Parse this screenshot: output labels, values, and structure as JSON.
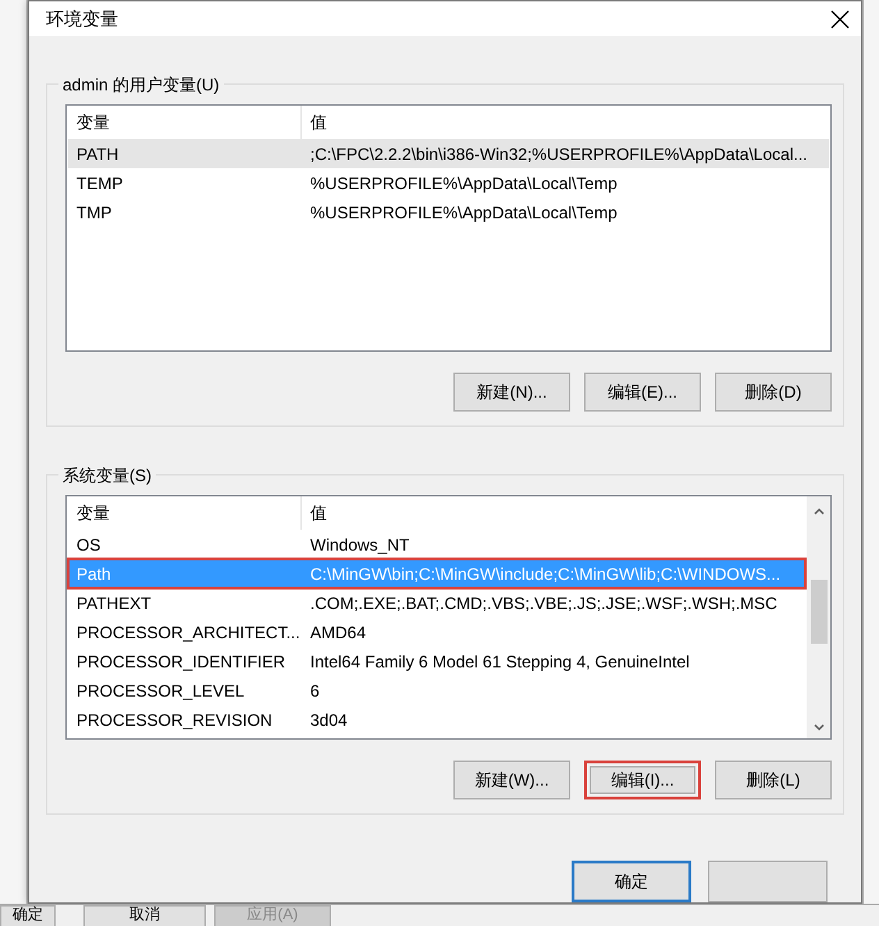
{
  "window": {
    "title": "环境变量"
  },
  "user_vars": {
    "label": "admin 的用户变量(U)",
    "columns": [
      "变量",
      "值"
    ],
    "rows": [
      {
        "name": "PATH",
        "value": ";C:\\FPC\\2.2.2\\bin\\i386-Win32;%USERPROFILE%\\AppData\\Local...",
        "selected": false,
        "hovered": true
      },
      {
        "name": "TEMP",
        "value": "%USERPROFILE%\\AppData\\Local\\Temp",
        "selected": false,
        "hovered": false
      },
      {
        "name": "TMP",
        "value": "%USERPROFILE%\\AppData\\Local\\Temp",
        "selected": false,
        "hovered": false
      }
    ],
    "buttons": [
      {
        "label": "新建(N)...",
        "annotated": false
      },
      {
        "label": "编辑(E)...",
        "annotated": false
      },
      {
        "label": "删除(D)",
        "annotated": false
      }
    ]
  },
  "system_vars": {
    "label": "系统变量(S)",
    "columns": [
      "变量",
      "值"
    ],
    "rows": [
      {
        "name": "OS",
        "value": "Windows_NT",
        "selected": false,
        "annotated": false
      },
      {
        "name": "Path",
        "value": "C:\\MinGW\\bin;C:\\MinGW\\include;C:\\MinGW\\lib;C:\\WINDOWS...",
        "selected": true,
        "annotated": true
      },
      {
        "name": "PATHEXT",
        "value": ".COM;.EXE;.BAT;.CMD;.VBS;.VBE;.JS;.JSE;.WSF;.WSH;.MSC",
        "selected": false,
        "annotated": false
      },
      {
        "name": "PROCESSOR_ARCHITECT...",
        "value": "AMD64",
        "selected": false,
        "annotated": false
      },
      {
        "name": "PROCESSOR_IDENTIFIER",
        "value": "Intel64 Family 6 Model 61 Stepping 4, GenuineIntel",
        "selected": false,
        "annotated": false
      },
      {
        "name": "PROCESSOR_LEVEL",
        "value": "6",
        "selected": false,
        "annotated": false
      },
      {
        "name": "PROCESSOR_REVISION",
        "value": "3d04",
        "selected": false,
        "annotated": false
      }
    ],
    "buttons": [
      {
        "label": "新建(W)...",
        "annotated": false
      },
      {
        "label": "编辑(I)...",
        "annotated": true
      },
      {
        "label": "删除(L)",
        "annotated": false
      }
    ]
  },
  "dialog_buttons": [
    {
      "label": "确定",
      "default": true
    },
    {
      "default": false
    }
  ],
  "background_window": {
    "buttons": [
      {
        "label": "确定",
        "disabled": false
      },
      {
        "label": "取消",
        "disabled": false
      },
      {
        "label": "应用(A)",
        "disabled": true
      }
    ]
  }
}
